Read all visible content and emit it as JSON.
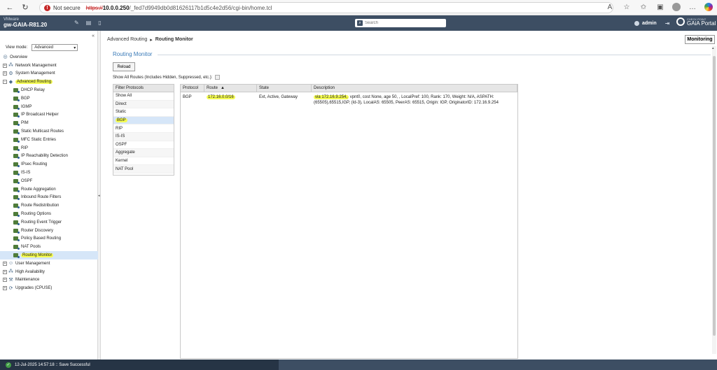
{
  "browser": {
    "not_secure": "Not secure",
    "url_scheme": "https://",
    "url_host": "10.0.0.250",
    "url_path": "/_fed7d9949db0d81626117b1d5c4e2d56/cgi-bin/home.tcl"
  },
  "header": {
    "brand": "VMware",
    "hostname": "gw-GAIA-R81.20",
    "search_placeholder": "Search",
    "user": "admin",
    "logo_top": "CHECK POINT",
    "logo_bottom": "GAiA Portal"
  },
  "sidebar": {
    "view_mode_label": "View mode:",
    "view_mode_value": "Advanced",
    "top": [
      {
        "label": "Overview"
      },
      {
        "label": "Network Management"
      },
      {
        "label": "System Management"
      },
      {
        "label": "Advanced Routing"
      }
    ],
    "sub": [
      {
        "label": "DHCP Relay"
      },
      {
        "label": "BGP"
      },
      {
        "label": "IGMP"
      },
      {
        "label": "IP Broadcast Helper"
      },
      {
        "label": "PIM"
      },
      {
        "label": "Static Multicast Routes"
      },
      {
        "label": "MFC Static Entries"
      },
      {
        "label": "RIP"
      },
      {
        "label": "IP Reachability Detection"
      },
      {
        "label": "IPsec Routing"
      },
      {
        "label": "IS-IS"
      },
      {
        "label": "OSPF"
      },
      {
        "label": "Route Aggregation"
      },
      {
        "label": "Inbound Route Filters"
      },
      {
        "label": "Route Redistribution"
      },
      {
        "label": "Routing Options"
      },
      {
        "label": "Routing Event Trigger"
      },
      {
        "label": "Router Discovery"
      },
      {
        "label": "Policy Based Routing"
      },
      {
        "label": "NAT Pools"
      },
      {
        "label": "Routing Monitor"
      }
    ],
    "bottom": [
      {
        "label": "User Management"
      },
      {
        "label": "High Availability"
      },
      {
        "label": "Maintenance"
      },
      {
        "label": "Upgrades (CPUSE)"
      }
    ]
  },
  "main": {
    "breadcrumb_parent": "Advanced Routing",
    "breadcrumb_sep": "▸",
    "breadcrumb_current": "Routing Monitor",
    "monitoring_button": "Monitoring",
    "section_title": "Routing Monitor",
    "reload_button": "Reload",
    "show_all_label": "Show All Routes (Includes Hidden, Suppressed, etc.):",
    "filter_header": "Filter Protocols",
    "filters": [
      "Show All",
      "Direct",
      "Static",
      "BGP",
      "RIP",
      "IS-IS",
      "OSPF",
      "Aggregate",
      "Kernel",
      "NAT Pool"
    ],
    "columns": {
      "protocol": "Protocol",
      "route": "Route",
      "route_sort": "▲",
      "state": "State",
      "description": "Description"
    },
    "rows": [
      {
        "protocol": "BGP",
        "route": "172.16.0.0/16",
        "state": "Ext, Active, Gateway",
        "desc_via": "via 172.16.9.254,",
        "desc_rest": " vpnt0, cost None, age 50, , LocalPref: 100, Rank: 170, Weight: N/A, ASPATH: (65505),65515,IGP, (Id-3), LocalAS: 65505, PeerAS: 65515, Origin: IGP, OriginatorID: 172.16.9.254"
      }
    ]
  },
  "status": {
    "text": "12-Jul-2025 14:57:18 :: Save Successful"
  }
}
